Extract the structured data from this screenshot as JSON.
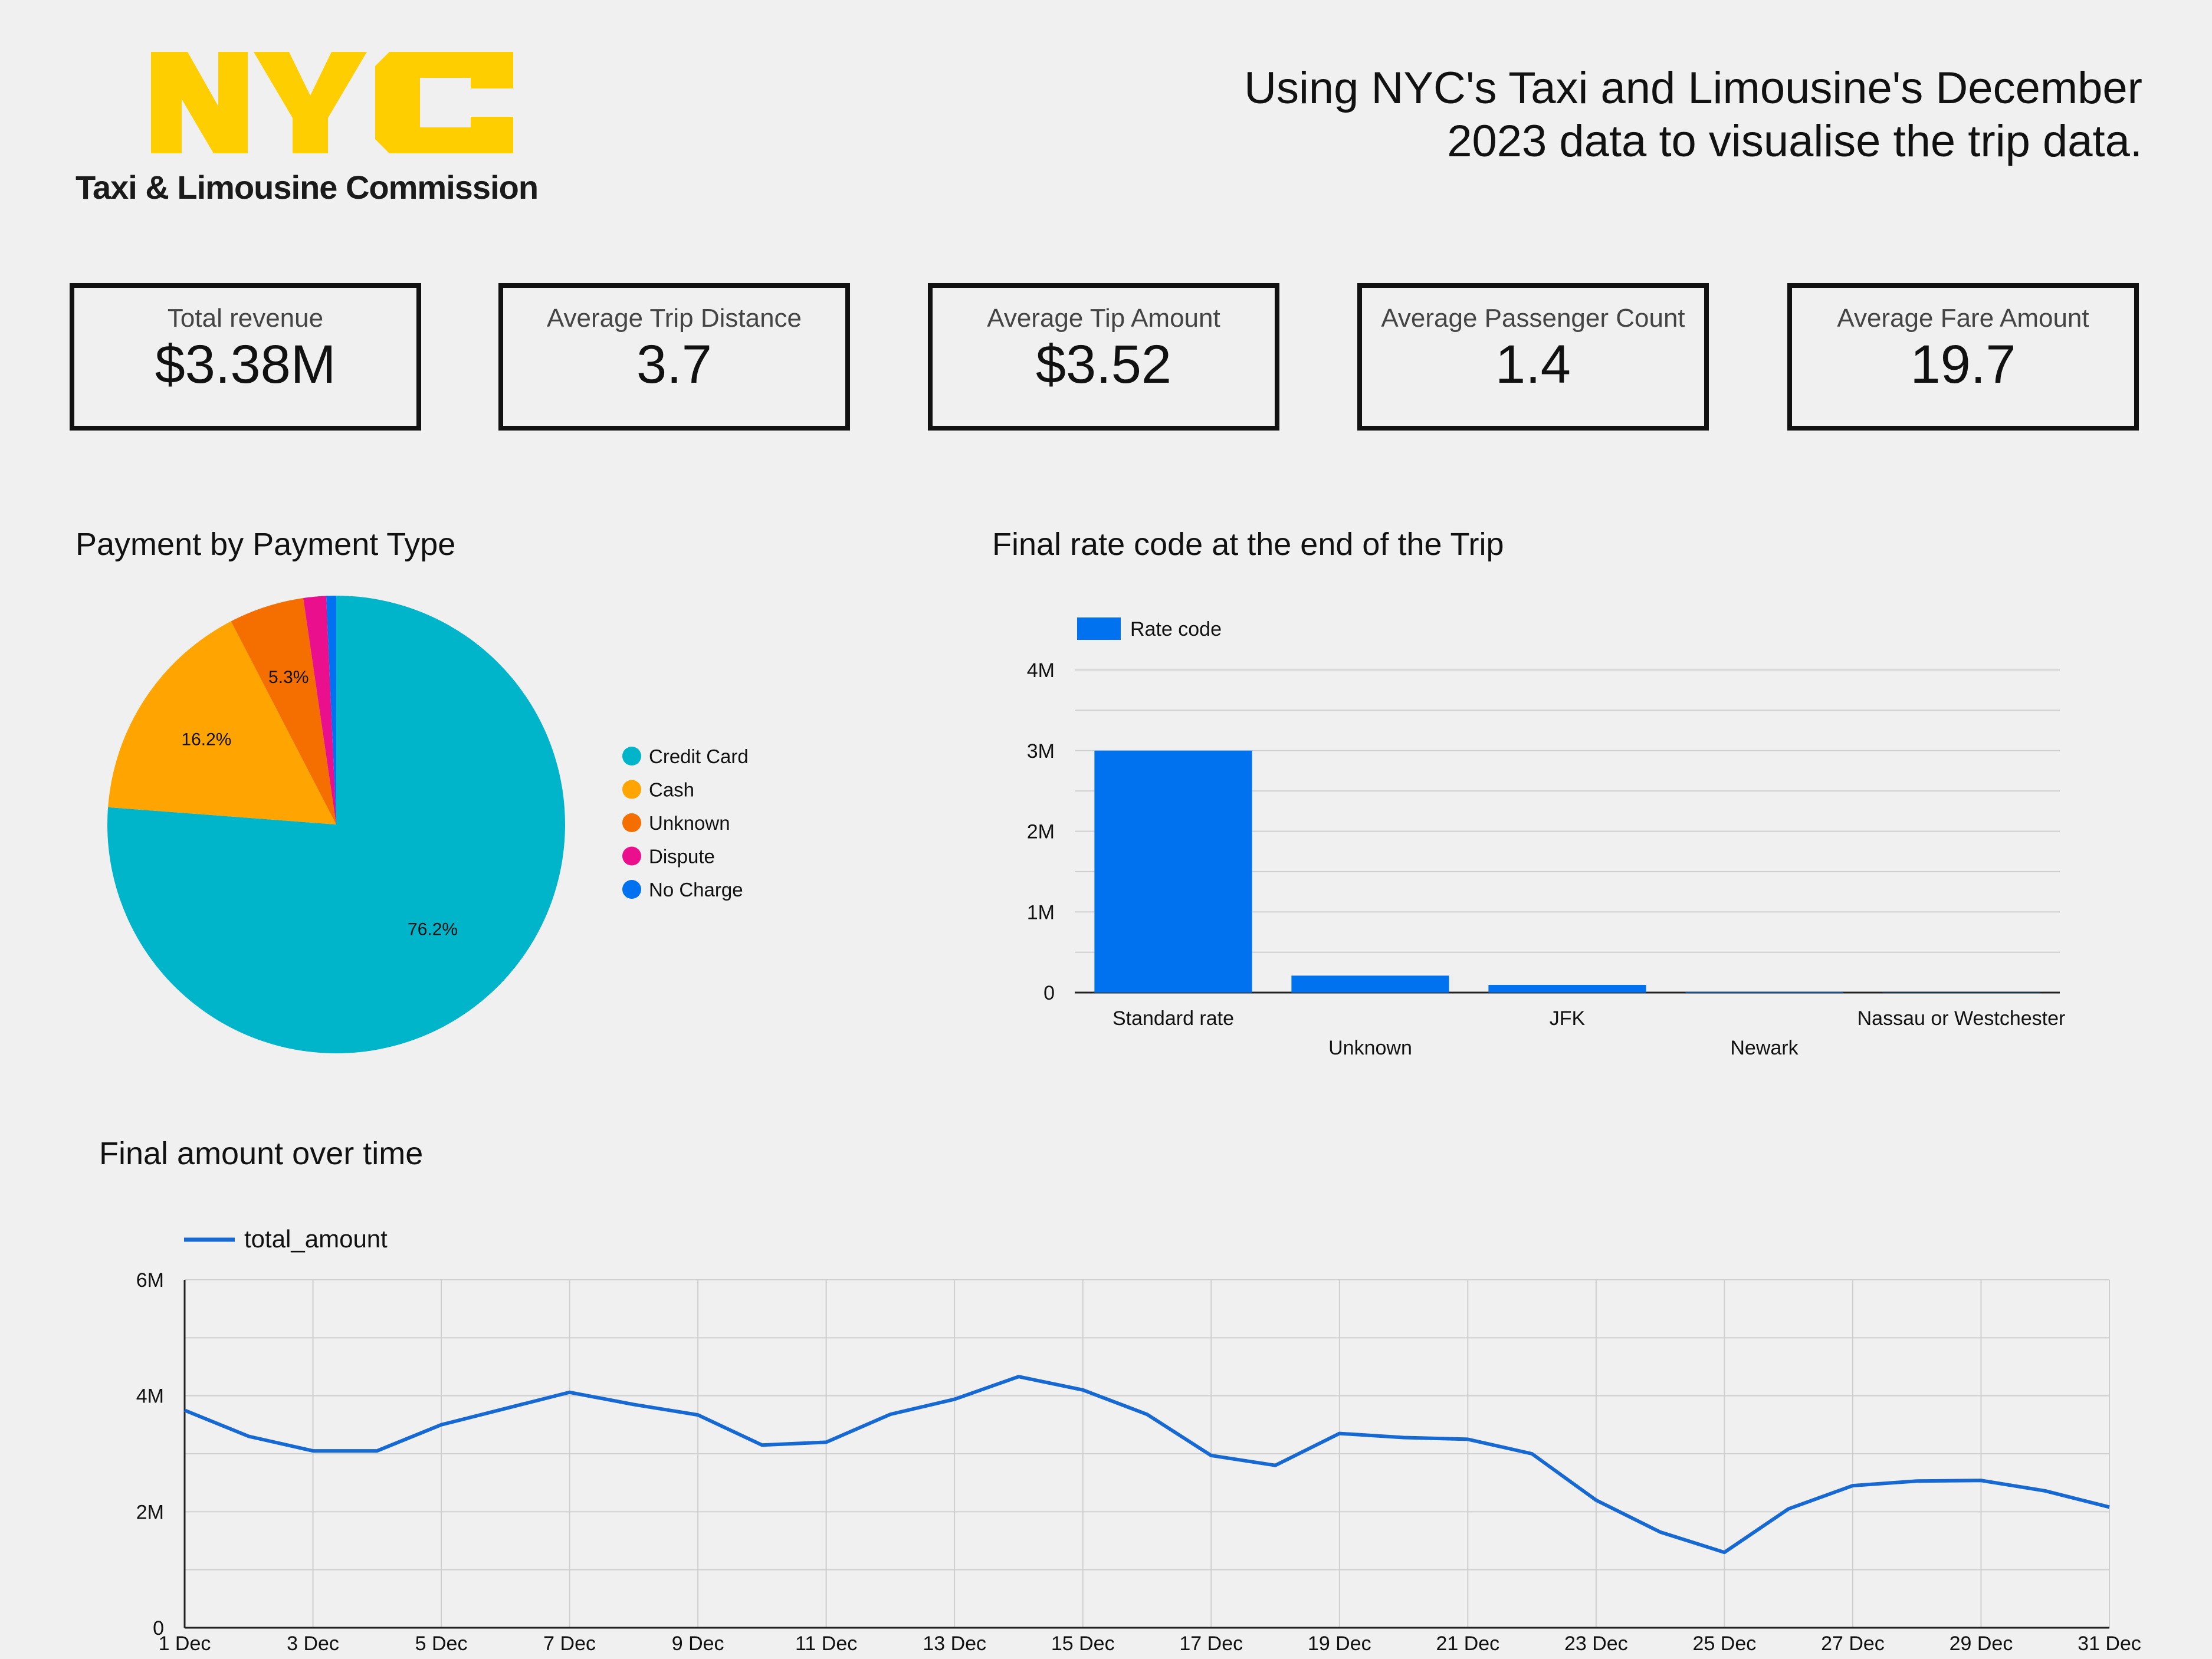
{
  "header": {
    "logo_text": "NYC",
    "logo_subtitle": "Taxi & Limousine Commission",
    "title": "Using NYC's Taxi and Limousine's December 2023 data to visualise the trip data.",
    "title_line1": "Using NYC's Taxi and Limousine's December",
    "title_line2": "2023 data to visualise the trip data."
  },
  "kpis": [
    {
      "label": "Total revenue",
      "value": "$3.38M"
    },
    {
      "label": "Average Trip Distance",
      "value": "3.7"
    },
    {
      "label": "Average Tip Amount",
      "value": "$3.52"
    },
    {
      "label": "Average Passenger Count",
      "value": "1.4"
    },
    {
      "label": "Average Fare Amount",
      "value": "19.7"
    }
  ],
  "colors": {
    "logo_yellow": "#FFCE00",
    "teal": "#00B4CA",
    "orange": "#FFA400",
    "dark_orange": "#F56E00",
    "pink": "#EA0F8C",
    "blue": "#0072F0",
    "line_blue": "#1669D2"
  },
  "chart_data": [
    {
      "type": "pie",
      "title": "Payment by Payment Type",
      "legend_position": "right",
      "categories": [
        "Credit Card",
        "Cash",
        "Unknown",
        "Dispute",
        "No Charge"
      ],
      "values": [
        76.2,
        16.2,
        5.3,
        1.6,
        0.7
      ],
      "labels": [
        "76.2%",
        "16.2%",
        "5.3%",
        "",
        ""
      ],
      "colors": [
        "#00B4CA",
        "#FFA400",
        "#F56E00",
        "#EA0F8C",
        "#0072F0"
      ]
    },
    {
      "type": "bar",
      "title": "Final rate code at the end of the Trip",
      "legend_position": "top-left",
      "series": [
        {
          "name": "Rate code",
          "values": [
            3000000,
            210000,
            95000,
            8000,
            3000
          ]
        }
      ],
      "categories": [
        "Standard rate",
        "Unknown",
        "JFK",
        "Newark",
        "Nassau or Westchester"
      ],
      "ylim": [
        0,
        4000000
      ],
      "yticks": [
        "0",
        "1M",
        "2M",
        "3M",
        "4M"
      ],
      "grid": true
    },
    {
      "type": "line",
      "title": "Final amount over time",
      "legend_position": "top-left",
      "series": [
        {
          "name": "total_amount",
          "values": [
            3.75,
            3.3,
            3.05,
            3.05,
            3.5,
            3.78,
            4.06,
            3.85,
            3.67,
            3.15,
            3.2,
            3.68,
            3.94,
            4.33,
            4.1,
            3.68,
            2.97,
            2.8,
            3.35,
            3.28,
            3.25,
            3.0,
            2.2,
            1.65,
            1.3,
            2.05,
            2.45,
            2.53,
            2.54,
            2.36,
            2.08
          ]
        }
      ],
      "x": [
        "1 Dec",
        "2 Dec",
        "3 Dec",
        "4 Dec",
        "5 Dec",
        "6 Dec",
        "7 Dec",
        "8 Dec",
        "9 Dec",
        "10 Dec",
        "11 Dec",
        "12 Dec",
        "13 Dec",
        "14 Dec",
        "15 Dec",
        "16 Dec",
        "17 Dec",
        "18 Dec",
        "19 Dec",
        "20 Dec",
        "21 Dec",
        "22 Dec",
        "23 Dec",
        "24 Dec",
        "25 Dec",
        "26 Dec",
        "27 Dec",
        "28 Dec",
        "29 Dec",
        "30 Dec",
        "31 Dec"
      ],
      "x_tick_labels": [
        "1 Dec",
        "3 Dec",
        "5 Dec",
        "7 Dec",
        "9 Dec",
        "11 Dec",
        "13 Dec",
        "15 Dec",
        "17 Dec",
        "19 Dec",
        "21 Dec",
        "23 Dec",
        "25 Dec",
        "27 Dec",
        "29 Dec",
        "31 Dec"
      ],
      "y_unit": "M",
      "ylim": [
        0,
        6
      ],
      "yticks": [
        "0",
        "2M",
        "4M",
        "6M"
      ],
      "grid": true
    }
  ]
}
